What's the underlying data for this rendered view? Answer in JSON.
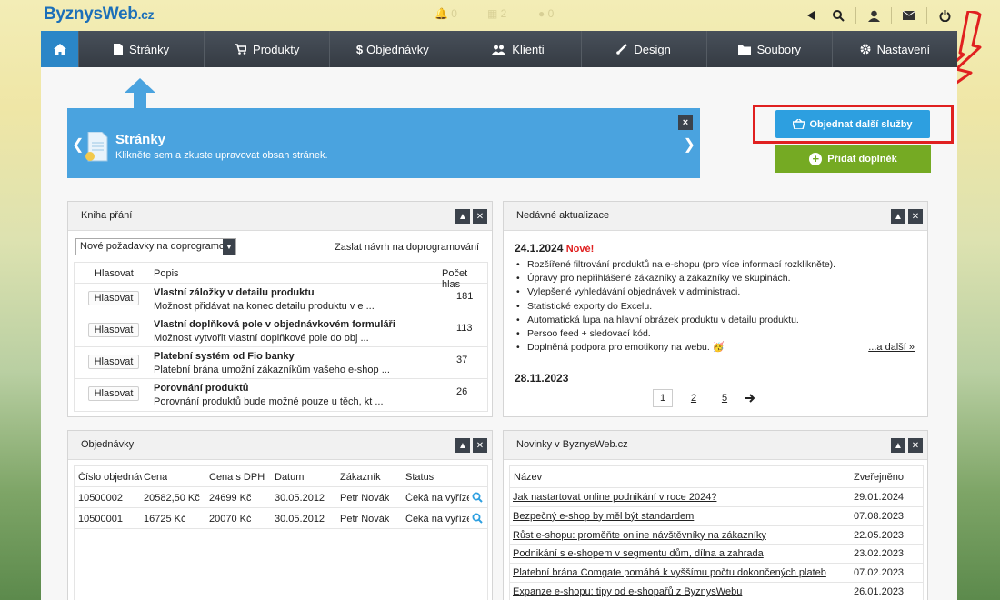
{
  "brand": {
    "name": "ByznysWeb",
    "tld": ".cz"
  },
  "topbar": {
    "ghost": [
      {
        "icon": "bell-icon",
        "count": "0"
      },
      {
        "icon": "calendar-icon",
        "count": "2"
      },
      {
        "icon": "help-icon",
        "count": "0"
      }
    ],
    "icons": [
      "arrow-left-icon",
      "search-icon",
      "user-icon",
      "mail-icon",
      "power-icon"
    ]
  },
  "nav": {
    "home_icon": "home-icon",
    "items": [
      {
        "label": "Stránky",
        "icon": "file-icon"
      },
      {
        "label": "Produkty",
        "icon": "cart-icon"
      },
      {
        "label": "Objednávky",
        "icon": "dollar-icon"
      },
      {
        "label": "Klienti",
        "icon": "users-icon"
      },
      {
        "label": "Design",
        "icon": "brush-icon"
      },
      {
        "label": "Soubory",
        "icon": "folder-icon"
      },
      {
        "label": "Nastavení",
        "icon": "gear-icon"
      }
    ]
  },
  "tip": {
    "title": "Stránky",
    "text": "Klikněte sem a zkuste upravovat obsah stránek.",
    "close": "×"
  },
  "actions": {
    "order": "Objednat další služby",
    "addon": "Přidat doplněk"
  },
  "wishlist": {
    "title": "Kniha přání",
    "select": "Nové požadavky na doprogramování",
    "link": "Zaslat návrh na doprogramování",
    "headers": {
      "vote": "Hlasovat",
      "desc": "Popis",
      "count": "Počet hlas"
    },
    "vote_label": "Hlasovat",
    "rows": [
      {
        "title": "Vlastní záložky v detailu produktu",
        "desc": "Možnost přidávat na konec detailu produktu v e ...",
        "count": "181"
      },
      {
        "title": "Vlastní doplňková pole v objednávkovém formuláři",
        "desc": "Možnost vytvořit vlastní doplňkové pole do obj ...",
        "count": "113"
      },
      {
        "title": "Platební systém od Fio banky",
        "desc": "Platební brána umožní zákazníkům vašeho e-shop ...",
        "count": "37"
      },
      {
        "title": "Porovnání produktů",
        "desc": "Porovnání produktů bude možné pouze u těch, kt ...",
        "count": "26"
      }
    ]
  },
  "updates": {
    "title": "Nedávné aktualizace",
    "date1": "24.1.2024",
    "new_badge": "Nové!",
    "items": [
      "Rozšířené filtrování produktů na e-shopu (pro více informací rozklikněte).",
      "Úpravy pro nepřihlášené zákazníky a zákazníky ve skupinách.",
      "Vylepšené vyhledávání objednávek v administraci.",
      "Statistické exporty do Excelu.",
      "Automatická lupa na hlavní obrázek produktu v detailu produktu.",
      "Persoo feed + sledovací kód.",
      "Doplněná podpora pro emotikony na webu. 🥳"
    ],
    "more": "...a další »",
    "date2": "28.11.2023",
    "pages": [
      "1",
      "2",
      "5"
    ]
  },
  "orders": {
    "title": "Objednávky",
    "headers": [
      "Číslo objednávky",
      "Cena",
      "Cena s DPH",
      "Datum",
      "Zákazník",
      "Status"
    ],
    "rows": [
      [
        "10500002",
        "20582,50 Kč",
        "24699 Kč",
        "30.05.2012",
        "Petr Novák",
        "Čeká na vyřízení"
      ],
      [
        "10500001",
        "16725 Kč",
        "20070 Kč",
        "30.05.2012",
        "Petr Novák",
        "Čeká na vyřízení"
      ]
    ]
  },
  "news": {
    "title": "Novinky v ByznysWeb.cz",
    "headers": {
      "name": "Název",
      "date": "Zveřejněno"
    },
    "rows": [
      {
        "title": "Jak nastartovat online podnikání v roce 2024?",
        "date": "29.01.2024"
      },
      {
        "title": "Bezpečný e-shop by měl být standardem",
        "date": "07.08.2023"
      },
      {
        "title": "Růst e-shopu: proměňte online návštěvníky na zákazníky",
        "date": "22.05.2023"
      },
      {
        "title": "Podnikání s e-shopem v segmentu dům, dílna a zahrada",
        "date": "23.02.2023"
      },
      {
        "title": "Platební brána Comgate pomáhá k vyššímu počtu dokončených plateb",
        "date": "07.02.2023"
      },
      {
        "title": "Expanze e-shopu: tipy od e-shopařů z ByznysWebu",
        "date": "26.01.2023"
      }
    ]
  },
  "colors": {
    "accent": "#4aa3df",
    "nav": "#3b424b",
    "green": "#75aa23",
    "annotation": "#e02020"
  }
}
